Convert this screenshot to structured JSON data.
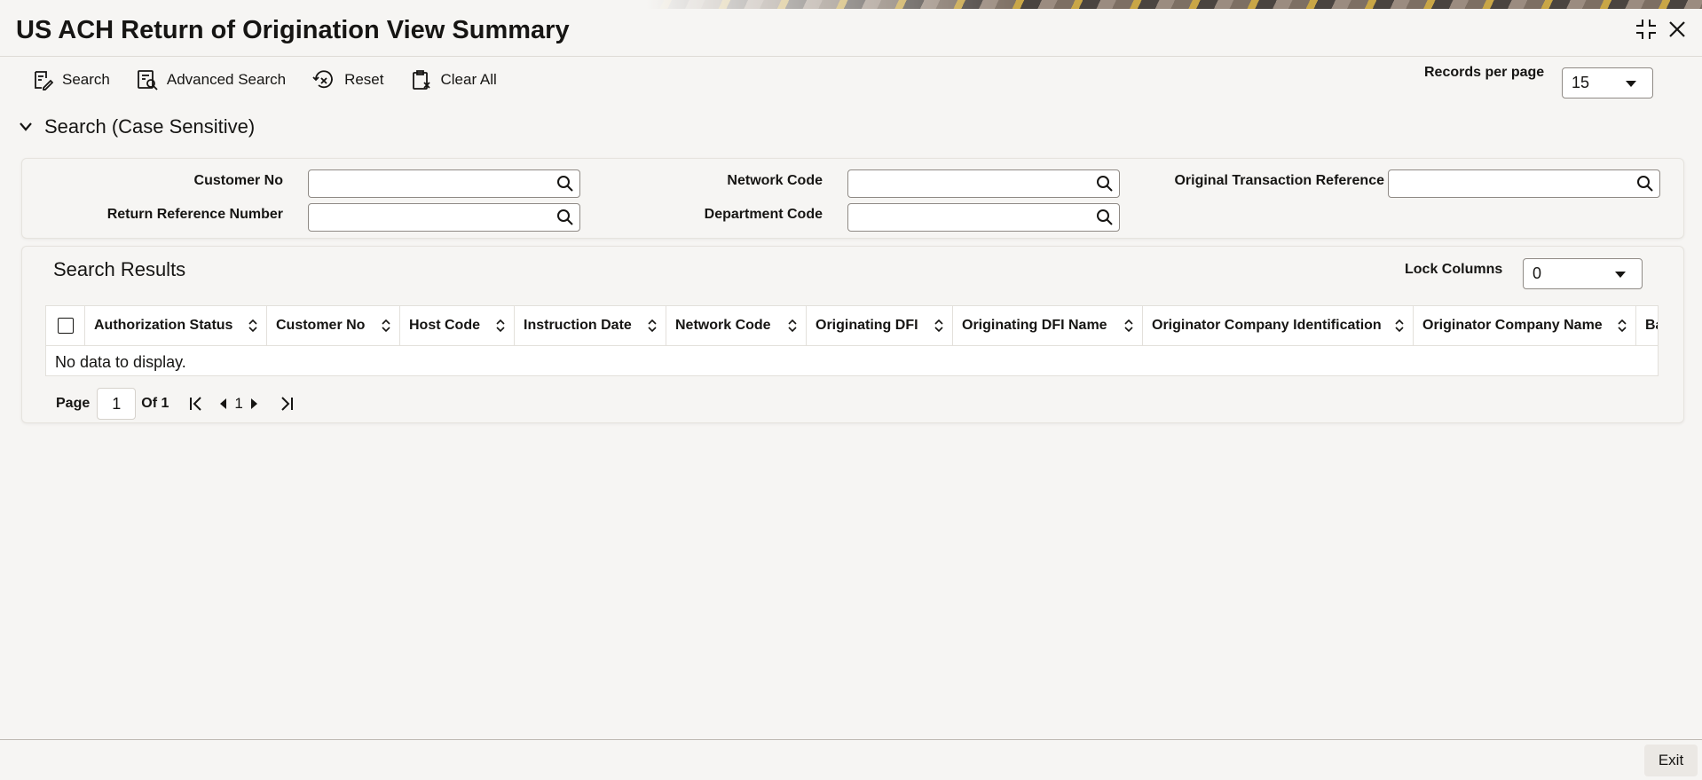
{
  "page": {
    "title": "US ACH Return of Origination View Summary"
  },
  "toolbar": {
    "search": "Search",
    "advanced_search": "Advanced Search",
    "reset": "Reset",
    "clear_all": "Clear All"
  },
  "records_per_page": {
    "label": "Records per page",
    "value": "15"
  },
  "search_section": {
    "title": "Search (Case Sensitive)",
    "fields": {
      "customer_no": {
        "label": "Customer No",
        "value": ""
      },
      "network_code": {
        "label": "Network Code",
        "value": ""
      },
      "original_transaction_reference": {
        "label": "Original Transaction Reference",
        "value": ""
      },
      "return_reference_number": {
        "label": "Return Reference Number",
        "value": ""
      },
      "department_code": {
        "label": "Department Code",
        "value": ""
      }
    }
  },
  "results": {
    "title": "Search Results",
    "lock_columns_label": "Lock Columns",
    "lock_columns_value": "0",
    "columns": [
      "Authorization Status",
      "Customer No",
      "Host Code",
      "Instruction Date",
      "Network Code",
      "Originating DFI",
      "Originating DFI Name",
      "Originator Company Identification",
      "Originator Company Name",
      "Ba"
    ],
    "empty_message": "No data to display."
  },
  "pagination": {
    "page_label": "Page",
    "current_page": "1",
    "of_label": "Of 1",
    "page_link": "1"
  },
  "footer": {
    "exit": "Exit"
  },
  "icons": {
    "maximize": "maximize-icon",
    "close": "close-icon",
    "search": "search-icon",
    "advanced_search": "advanced-search-icon",
    "reset": "reset-icon",
    "clear_all": "clear-all-icon",
    "chevron": "chevron-down-icon",
    "magnifier": "magnifier-icon",
    "sort": "sort-icon"
  }
}
